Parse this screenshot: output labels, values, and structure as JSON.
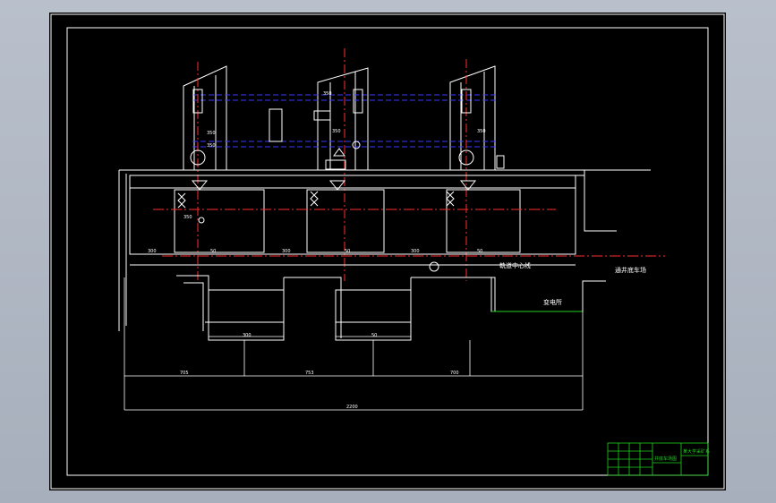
{
  "diagram": {
    "labels": {
      "control_center": "軌道中心线",
      "depot": "通井底车场",
      "substation": "变电所"
    },
    "dimensions": {
      "d1": "300",
      "d2": "50",
      "d3": "300",
      "d4": "50",
      "d5": "300",
      "d6": "50",
      "d7": "300",
      "d8": "50",
      "d9": "50",
      "d10": "50",
      "d11": "705",
      "d12": "753",
      "d13": "700",
      "d14": "2200",
      "t1": "350",
      "t2": "350",
      "t3": "350",
      "t4": "350",
      "t5": "350",
      "t6": "350"
    },
    "title_block": {
      "drawing_name": "井底车场图",
      "school": "某大学采矿系"
    },
    "colors": {
      "sheet": "#000000",
      "line": "#ffffff",
      "axis": "#ff2b2b",
      "pipe": "#3a3aff",
      "ground": "#1fd11f"
    }
  }
}
